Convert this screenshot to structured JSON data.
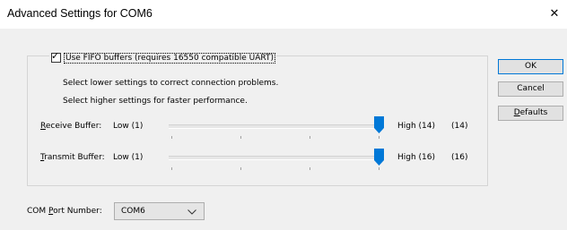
{
  "window": {
    "title": "Advanced Settings for COM6",
    "close_glyph": "✕"
  },
  "fifo": {
    "checked": true,
    "label": "Use FIFO buffers (requires 16550 compatible UART)"
  },
  "info": {
    "line1": "Select lower settings to correct connection problems.",
    "line2": "Select higher settings for faster performance."
  },
  "receive": {
    "label_access": "R",
    "label_rest": "eceive Buffer:",
    "low": "Low (1)",
    "high": "High (14)",
    "value": "(14)"
  },
  "transmit": {
    "label_access": "T",
    "label_rest": "ransmit Buffer:",
    "low": "Low (1)",
    "high": "High (16)",
    "value": "(16)"
  },
  "buttons": {
    "ok": "OK",
    "cancel": "Cancel",
    "defaults_access": "D",
    "defaults_rest": "efaults"
  },
  "com_port": {
    "label_before": "COM ",
    "label_access": "P",
    "label_after": "ort Number:",
    "value": "COM6"
  },
  "colors": {
    "accent": "#0078d7",
    "background": "#f0f0f0"
  }
}
